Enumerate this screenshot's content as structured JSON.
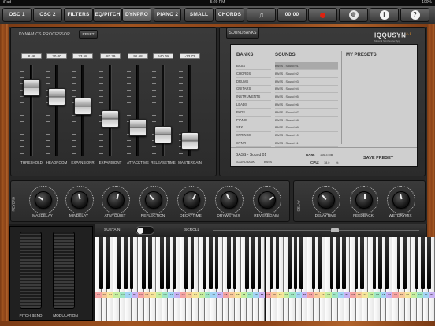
{
  "status": {
    "device": "iPad",
    "time": "5:29 PM",
    "battery": "100%"
  },
  "tabs": [
    {
      "label": "OSC 1"
    },
    {
      "label": "OSC 2"
    },
    {
      "label": "FILTERS"
    },
    {
      "label": "EQ/PITCH"
    },
    {
      "label": "DYNPRO",
      "active": true
    },
    {
      "label": "PIANO 2"
    },
    {
      "label": "SMALL"
    },
    {
      "label": "CHORDS"
    }
  ],
  "toolbar": {
    "timer": "00:00",
    "music_icon": "music-note-icon",
    "record_icon": "record-icon",
    "globe_icon": "globe-icon",
    "info_icon": "info-icon",
    "help_icon": "help-icon"
  },
  "dynamics": {
    "title": "DYNAMICS PROCESSOR",
    "reset_label": "RESET",
    "faders": [
      {
        "label": "THRESHOLD",
        "value": "8.46",
        "level": 0.18
      },
      {
        "label": "HEADROOM",
        "value": "30.00",
        "level": 0.3
      },
      {
        "label": "EXPANSIONR",
        "value": "33.58",
        "level": 0.42
      },
      {
        "label": "EXPANSIONT",
        "value": "-83.29",
        "level": 0.58
      },
      {
        "label": "ATTACKTIME",
        "value": "91.68",
        "level": 0.69
      },
      {
        "label": "RELEASETIME",
        "value": "640.09",
        "level": 0.78
      },
      {
        "label": "MASTERGAIN",
        "value": "-33.72",
        "level": 0.86
      }
    ]
  },
  "soundbanks": {
    "tab_label": "SOUNDBANKS",
    "logo": "IQQUSYN",
    "logo_version": "2.0",
    "logo_sub": "Musical Synthesizer App",
    "headers": {
      "banks": "BANKS",
      "sounds": "SOUNDS",
      "presets": "MY PRESETS"
    },
    "banks": [
      "BASS",
      "CHORDS",
      "DRUMS",
      "GUITARS",
      "INSTRUMENTS",
      "LEADS",
      "PADS",
      "PIANO",
      "SFX",
      "STRINGS",
      "SYNTH"
    ],
    "sounds": [
      "BASS - Sound 01",
      "BASS - Sound 02",
      "BASS - Sound 03",
      "BASS - Sound 04",
      "BASS - Sound 05",
      "BASS - Sound 06",
      "BASS - Sound 07",
      "BASS - Sound 08",
      "BASS - Sound 09",
      "BASS - Sound 10",
      "BASS - Sound 11"
    ],
    "selected_sound": "BASS - Sound 01",
    "soundbank_label": "SOUNDBANK",
    "soundbank_value": "BASS",
    "ram_label": "RAM:",
    "ram_value": "106.3 MB",
    "cpu_label": "CPU:",
    "cpu_value": "18.0",
    "cpu_unit": "%",
    "save_preset": "SAVE PRESET"
  },
  "reverb": {
    "section_label": "REVERB",
    "knobs": [
      {
        "label": "MAXDELAY",
        "level": 0.3
      },
      {
        "label": "MINDELAY",
        "level": 0.45
      },
      {
        "label": "ATNYQUIST",
        "level": 0.55
      },
      {
        "label": "REFLECTION",
        "level": 0.35
      },
      {
        "label": "DECAYTIME",
        "level": 0.6
      },
      {
        "label": "DRYWETMIX",
        "level": 0.4
      },
      {
        "label": "REVERBGAIN",
        "level": 0.7
      }
    ]
  },
  "delay": {
    "section_label": "DELAY",
    "knobs": [
      {
        "label": "DELAYTIME",
        "level": 0.35
      },
      {
        "label": "FEEDBACK",
        "level": 0.5
      },
      {
        "label": "WETDRYMIX",
        "level": 0.45
      }
    ]
  },
  "controls": {
    "sustain_label": "SUSTAIN",
    "scroll_label": "SCROLL",
    "pitch_bend_label": "PITCH BEND",
    "modulation_label": "MODULATION"
  },
  "keyboard": {
    "notes": [
      "C2",
      "D2",
      "E2",
      "F2",
      "G2",
      "A2",
      "B2",
      "C3",
      "D3",
      "E3",
      "F3",
      "G3",
      "A3",
      "B3",
      "C4",
      "D4",
      "E4",
      "F4",
      "G4",
      "A4",
      "B4",
      "C5",
      "D5",
      "E5",
      "F5",
      "G5",
      "A5",
      "B5",
      "C6",
      "D6",
      "E6",
      "F6",
      "G6",
      "A6",
      "B6",
      "C7",
      "D7",
      "E7",
      "F7",
      "G7",
      "A7",
      "B7",
      "C8",
      "D8",
      "E8",
      "F8",
      "G8",
      "A8",
      "B8",
      "C9",
      "D9",
      "E9",
      "F9",
      "G9",
      "A9",
      "B9"
    ],
    "note_colors": [
      "#f4a3a3",
      "#f7c89a",
      "#f5e59a",
      "#c6eea0",
      "#9fe6c4",
      "#a3d4f4",
      "#c8b2f2"
    ]
  }
}
